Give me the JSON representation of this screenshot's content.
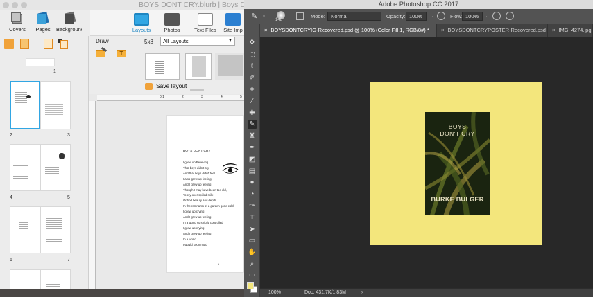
{
  "blurb": {
    "title": "BOYS DONT CRY.blurb | Boys Don't",
    "toolbar": {
      "covers": "Covers",
      "pages": "Pages",
      "background": "Background"
    },
    "first_page_number": "1",
    "spreads": [
      {
        "left": "2",
        "right": "3"
      },
      {
        "left": "4",
        "right": "5"
      },
      {
        "left": "6",
        "right": "7"
      }
    ],
    "layout_tabs": [
      {
        "label": "Layouts",
        "icon": "layouts-icon"
      },
      {
        "label": "Photos",
        "icon": "photos-icon"
      },
      {
        "label": "Text Files",
        "icon": "text-files-icon"
      },
      {
        "label": "Site Imp",
        "icon": "site-import-icon"
      }
    ],
    "draw_label": "Draw",
    "size_label": "5x8",
    "layout_select": "All Layouts",
    "save_layout": "Save layout",
    "ruler_marks": [
      "0|1",
      "2",
      "3",
      "4",
      "5"
    ],
    "page": {
      "heading": "BOYS DONT CRY",
      "lines": [
        "I grew up Believing",
        "That boys didn't cry",
        "And that boys didn't feel",
        "I also grew up feeling",
        "And I grew up feeling",
        "Though I may have been too old,",
        "To cry over spilled milk",
        "Or find beauty and depth",
        "In the remnants of a garden gone cold",
        "I grew up crying",
        "And I grew up feeling",
        "In a world so strictly controlled",
        "I grew up crying",
        "And I grew up feeling",
        "In a world",
        "I would soon mold"
      ],
      "page_number": "1"
    }
  },
  "photoshop": {
    "app_title": "Adobe Photoshop CC 2017",
    "options": {
      "brush_size": "148",
      "mode_label": "Mode:",
      "mode_value": "Normal",
      "opacity_label": "Opacity:",
      "opacity_value": "100%",
      "flow_label": "Flow:",
      "flow_value": "100%"
    },
    "tabs": [
      {
        "label": "BOYSDONTCRYIG-Recovered.psd @ 100% (Color Fill 1, RGB/8#) *",
        "active": true
      },
      {
        "label": "BOYSDONTCRYPOSTER-Recovered.psd",
        "active": false
      },
      {
        "label": "IMG_4274.jpg",
        "active": false
      }
    ],
    "artwork": {
      "title_line1": "BOYS",
      "title_line2": "DON'T CRY",
      "author": "BURKE BULGER",
      "background_color": "#f3e67c"
    },
    "status": {
      "zoom": "100%",
      "doc": "Doc: 431.7K/1.83M"
    },
    "foreground_color": "#f3e67c"
  }
}
